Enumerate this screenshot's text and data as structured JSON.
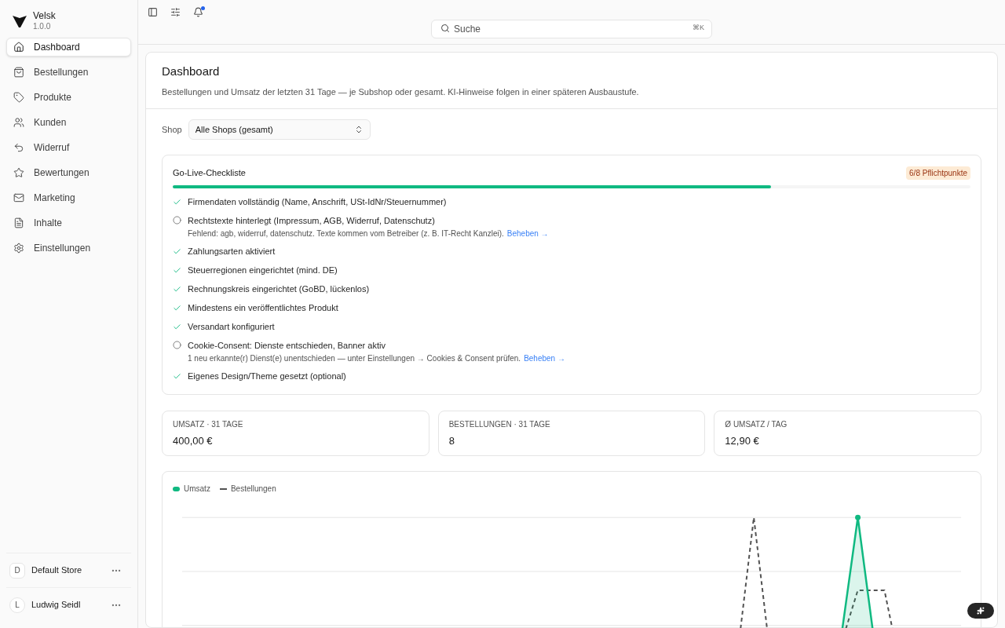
{
  "brand": {
    "name": "Velsk",
    "version": "1.0.0"
  },
  "nav": [
    {
      "label": "Dashboard",
      "selected": true
    },
    {
      "label": "Bestellungen",
      "selected": false
    },
    {
      "label": "Produkte",
      "selected": false
    },
    {
      "label": "Kunden",
      "selected": false
    },
    {
      "label": "Widerruf",
      "selected": false
    },
    {
      "label": "Bewertungen",
      "selected": false
    },
    {
      "label": "Marketing",
      "selected": false
    },
    {
      "label": "Inhalte",
      "selected": false
    },
    {
      "label": "Einstellungen",
      "selected": false
    }
  ],
  "store": {
    "initial": "D",
    "name": "Default Store"
  },
  "user": {
    "initial": "L",
    "name": "Ludwig Seidl"
  },
  "topbar": {
    "notification": true
  },
  "search": {
    "placeholder": "Suche",
    "shortcut": "⌘K"
  },
  "page": {
    "title": "Dashboard",
    "description": "Bestellungen und Umsatz der letzten 31 Tage — je Subshop oder gesamt. KI-Hinweise folgen in einer späteren Ausbaustufe."
  },
  "shop_filter": {
    "label": "Shop",
    "value": "Alle Shops (gesamt)"
  },
  "checklist": {
    "title": "Go-Live-Checkliste",
    "badge": "6/8 Pflichtpunkte",
    "level": 0.75,
    "items": [
      {
        "label": "Firmendaten vollständig (Name, Anschrift, USt-IdNr/Steuernummer)",
        "done": true
      },
      {
        "label": "Rechtstexte hinterlegt (Impressum, AGB, Widerruf, Datenschutz)",
        "done": false,
        "note": "Fehlend: agb, widerruf, datenschutz. Texte kommen vom Betreiber (z. B. IT-Recht Kanzlei).",
        "link": "Beheben →"
      },
      {
        "label": "Zahlungsarten aktiviert",
        "done": true
      },
      {
        "label": "Steuerregionen eingerichtet (mind. DE)",
        "done": true
      },
      {
        "label": "Rechnungskreis eingerichtet (GoBD, lückenlos)",
        "done": true
      },
      {
        "label": "Mindestens ein veröffentlichtes Produkt",
        "done": true
      },
      {
        "label": "Versandart konfiguriert",
        "done": true
      },
      {
        "label": "Cookie-Consent: Dienste entschieden, Banner aktiv",
        "done": false,
        "note": "1 neu erkannte(r) Dienst(e) unentschieden — unter Einstellungen → Cookies & Consent prüfen.",
        "link": "Beheben →"
      },
      {
        "label": "Eigenes Design/Theme gesetzt (optional)",
        "done": true
      }
    ]
  },
  "stats": [
    {
      "label": "UMSATZ · 31 TAGE",
      "value": "400,00 €"
    },
    {
      "label": "BESTELLUNGEN · 31 TAGE",
      "value": "8"
    },
    {
      "label": "Ø UMSATZ / TAG",
      "value": "12,90 €"
    }
  ],
  "chart": {
    "legend": [
      {
        "label": "Umsatz",
        "kind": "area",
        "color": "#10b981"
      },
      {
        "label": "Bestellungen",
        "kind": "dashed",
        "color": "#525252"
      }
    ]
  }
}
